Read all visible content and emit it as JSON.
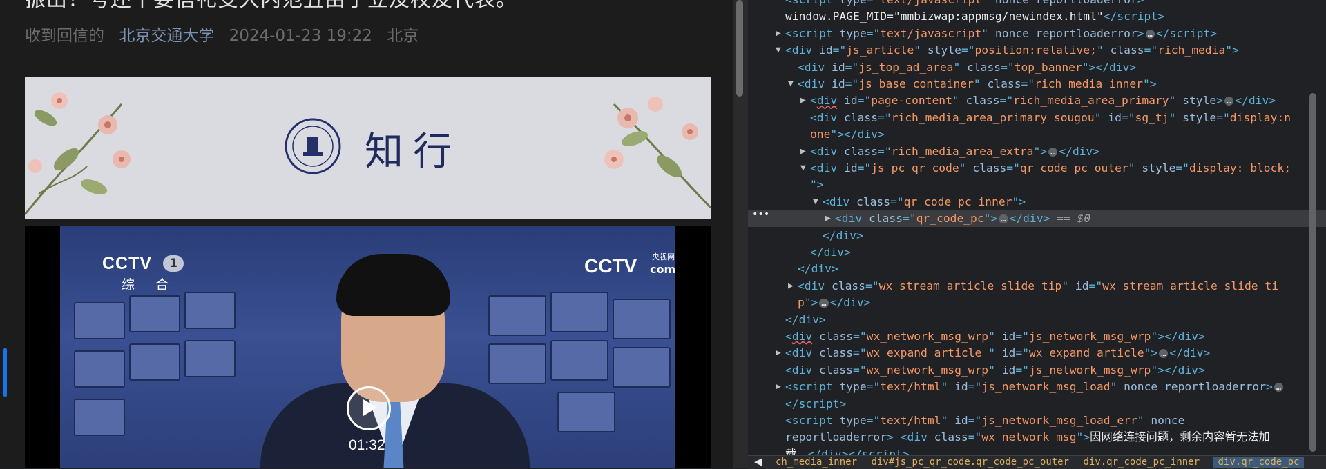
{
  "article": {
    "title": "振出！号还个要信礼受大内范丑由于立及校友代表。",
    "meta": {
      "author": "收到回信的",
      "account": "北京交通大学",
      "date": "2024-01-23 19:22",
      "location": "北京"
    },
    "banner": {
      "title": "知行",
      "seal_text": "北京交通大学 BEIJING JIAOTONG UNIVERSITY 1896"
    },
    "video": {
      "channel_logo": "CCTV",
      "channel_number": "1",
      "channel_sub": "综 合",
      "watermark": "CCTV",
      "watermark_sub": "央视网",
      "watermark_com": "com",
      "duration": "01:32"
    }
  },
  "devtools": {
    "lines": [
      {
        "indent": 0,
        "tri": "",
        "html": "<span class='txt'>  </span><span class='tag'>&lt;script </span><span class='attr'>type</span><span class='tag'>=\"</span><span class='val'>text/javascript</span><span class='tag'>\" </span><span class='attr'>nonce reportloaderror</span><span class='tag'>&gt;</span>"
      },
      {
        "indent": 0,
        "tri": "",
        "html": "<span class='txt'>window.PAGE_MID=\"mmbizwap:appmsg/newindex.html\"</span><span class='tag'>&lt;/script&gt;</span>"
      },
      {
        "indent": 0,
        "tri": "▶",
        "html": "<span class='tag'>&lt;script </span><span class='attr'>type</span><span class='tag'>=\"</span><span class='val'>text/javascript</span><span class='tag'>\" </span><span class='attr'>nonce reportloaderror</span><span class='tag'>&gt;</span><span class='ell'>…</span><span class='tag'>&lt;/script&gt;</span>"
      },
      {
        "indent": 0,
        "tri": "▼",
        "html": "<span class='tag'>&lt;div </span><span class='attr'>id</span><span class='tag'>=\"</span><span class='val'>js_article</span><span class='tag'>\" </span><span class='attr'>style</span><span class='tag'>=\"</span><span class='val'>position:relative;</span><span class='tag'>\" </span><span class='attr'>class</span><span class='tag'>=\"</span><span class='val'>rich_media</span><span class='tag'>\"&gt;</span>"
      },
      {
        "indent": 1,
        "tri": "",
        "html": "<span class='tag'>&lt;div </span><span class='attr'>id</span><span class='tag'>=\"</span><span class='val'>js_top_ad_area</span><span class='tag'>\" </span><span class='attr'>class</span><span class='tag'>=\"</span><span class='val'>top_banner</span><span class='tag'>\"&gt;&lt;/div&gt;</span>"
      },
      {
        "indent": 1,
        "tri": "▼",
        "html": "<span class='tag'>&lt;div </span><span class='attr'>id</span><span class='tag'>=\"</span><span class='val'>js_base_container</span><span class='tag'>\" </span><span class='attr'>class</span><span class='tag'>=\"</span><span class='val'>rich_media_inner</span><span class='tag'>\"&gt;</span>"
      },
      {
        "indent": 2,
        "tri": "▶",
        "html": "<span class='tag'>&lt;<span class='wavy'>div</span> </span><span class='attr'>id</span><span class='tag'>=\"</span><span class='val'>page-content</span><span class='tag'>\" </span><span class='attr'>class</span><span class='tag'>=\"</span><span class='val'>rich_media_area_primary</span><span class='tag'>\" </span><span class='attr'>style</span><span class='tag'>&gt;</span><span class='ell'>…</span><span class='tag'>&lt;/div&gt;</span>"
      },
      {
        "indent": 2,
        "tri": "",
        "html": "<span class='tag'>&lt;div </span><span class='attr'>class</span><span class='tag'>=\"</span><span class='val'>rich_media_area_primary sougou</span><span class='tag'>\" </span><span class='attr'>id</span><span class='tag'>=\"</span><span class='val'>sg_tj</span><span class='tag'>\" </span><span class='attr'>style</span><span class='tag'>=\"</span><span class='val'>display:n</span>"
      },
      {
        "indent": 2,
        "tri": "",
        "html": "<span class='val'>one</span><span class='tag'>\"&gt;&lt;/div&gt;</span>"
      },
      {
        "indent": 2,
        "tri": "▶",
        "html": "<span class='tag'>&lt;div </span><span class='attr'>class</span><span class='tag'>=\"</span><span class='val'>rich_media_area_extra</span><span class='tag'>\"&gt;</span><span class='ell'>…</span><span class='tag'>&lt;/div&gt;</span>"
      },
      {
        "indent": 2,
        "tri": "▼",
        "html": "<span class='tag'>&lt;div </span><span class='attr'>id</span><span class='tag'>=\"</span><span class='val'>js_pc_qr_code</span><span class='tag'>\" </span><span class='attr'>class</span><span class='tag'>=\"</span><span class='val'>qr_code_pc_outer</span><span class='tag'>\" </span><span class='attr'>style</span><span class='tag'>=\"</span><span class='val'>display: block;</span>"
      },
      {
        "indent": 2,
        "tri": "",
        "html": "<span class='tag'>\"&gt;</span>"
      },
      {
        "indent": 3,
        "tri": "▼",
        "html": "<span class='tag'>&lt;div </span><span class='attr'>class</span><span class='tag'>=\"</span><span class='val'>qr_code_pc_inner</span><span class='tag'>\"&gt;</span>"
      },
      {
        "indent": 4,
        "tri": "▶",
        "sel": true,
        "html": "<span class='tag'>&lt;div </span><span class='attr'>class</span><span class='tag'>=\"</span><span class='val'>qr_code_pc</span><span class='tag'>\"&gt;</span><span class='ell'>…</span><span class='tag'>&lt;/div&gt;</span><span class='dollar'> == $0</span>"
      },
      {
        "indent": 3,
        "tri": "",
        "html": "<span class='tag'>&lt;/div&gt;</span>"
      },
      {
        "indent": 2,
        "tri": "",
        "html": "<span class='tag'>&lt;/div&gt;</span>"
      },
      {
        "indent": 1,
        "tri": "",
        "html": "<span class='tag'>&lt;/div&gt;</span>"
      },
      {
        "indent": 1,
        "tri": "▶",
        "html": "<span class='tag'>&lt;div </span><span class='attr'>class</span><span class='tag'>=\"</span><span class='val'>wx_stream_article_slide_tip</span><span class='tag'>\" </span><span class='attr'>id</span><span class='tag'>=\"</span><span class='val'>wx_stream_article_slide_ti</span>"
      },
      {
        "indent": 1,
        "tri": "",
        "html": "<span class='val'>p</span><span class='tag'>\"&gt;</span><span class='ell'>…</span><span class='tag'>&lt;/div&gt;</span>"
      },
      {
        "indent": 0,
        "tri": "",
        "html": "<span class='tag'>&lt;/div&gt;</span>"
      },
      {
        "indent": 0,
        "tri": "",
        "html": "<span class='tag'>&lt;<span class='wavy'>div</span> </span><span class='attr'>class</span><span class='tag'>=\"</span><span class='val'>wx_network_msg_wrp</span><span class='tag'>\" </span><span class='attr'>id</span><span class='tag'>=\"</span><span class='val'>js_network_msg_wrp</span><span class='tag'>\"&gt;&lt;/div&gt;</span>"
      },
      {
        "indent": 0,
        "tri": "▶",
        "html": "<span class='tag'>&lt;div </span><span class='attr'>class</span><span class='tag'>=\"</span><span class='val'>wx_expand_article </span><span class='tag'>\" </span><span class='attr'>id</span><span class='tag'>=\"</span><span class='val'>wx_expand_article</span><span class='tag'>\"&gt;</span><span class='ell'>…</span><span class='tag'>&lt;/div&gt;</span>"
      },
      {
        "indent": 0,
        "tri": "",
        "html": "<span class='tag'>&lt;div </span><span class='attr'>class</span><span class='tag'>=\"</span><span class='val'>wx_network_msg_wrp</span><span class='tag'>\" </span><span class='attr'>id</span><span class='tag'>=\"</span><span class='val'>js_network_msg_wrp</span><span class='tag'>\"&gt;&lt;/div&gt;</span>"
      },
      {
        "indent": 0,
        "tri": "▶",
        "html": "<span class='tag'>&lt;script </span><span class='attr'>type</span><span class='tag'>=\"</span><span class='val'>text/html</span><span class='tag'>\" </span><span class='attr'>id</span><span class='tag'>=\"</span><span class='val'>js_network_msg_load</span><span class='tag'>\" </span><span class='attr'>nonce reportloaderror</span><span class='tag'>&gt;</span><span class='ell'>…</span>"
      },
      {
        "indent": 0,
        "tri": "",
        "html": "<span class='tag'>&lt;/script&gt;</span>"
      },
      {
        "indent": 0,
        "tri": "",
        "html": "<span class='tag'>&lt;script </span><span class='attr'>type</span><span class='tag'>=\"</span><span class='val'>text/html</span><span class='tag'>\" </span><span class='attr'>id</span><span class='tag'>=\"</span><span class='val'>js_network_msg_load_err</span><span class='tag'>\" </span><span class='attr'>nonce</span>"
      },
      {
        "indent": 0,
        "tri": "",
        "html": "<span class='attr'>reportloaderror</span><span class='tag'>&gt; </span><span class='tag'>&lt;div </span><span class='attr'>class</span><span class='tag'>=\"</span><span class='val'>wx_network_msg</span><span class='tag'>\"&gt;</span><span class='txt'>因网络连接问题，剩余内容暂无法加</span>"
      },
      {
        "indent": 0,
        "tri": "",
        "html": "<span class='txt'>载。</span><span class='tag'>&lt;/div&gt;&lt;/script&gt;</span>"
      }
    ],
    "breadcrumb": [
      "ch_media_inner",
      "div#js_pc_qr_code.qr_code_pc_outer",
      "div.qr_code_pc_inner",
      "div.qr_code_pc"
    ],
    "back_arrow": "◀"
  }
}
